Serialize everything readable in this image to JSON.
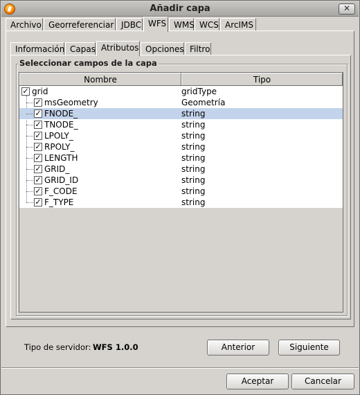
{
  "window": {
    "title": "Añadir capa"
  },
  "main_tabs": [
    "Archivo",
    "Georreferenciar",
    "JDBC",
    "WFS",
    "WMS",
    "WCS",
    "ArcIMS"
  ],
  "main_tab_selected": "WFS",
  "sub_tabs": [
    "Información",
    "Capas",
    "Atributos",
    "Opciones",
    "Filtro"
  ],
  "sub_tab_selected": "Atributos",
  "fields_group": {
    "title": "Seleccionar campos de la capa",
    "columns": [
      "Nombre",
      "Tipo"
    ],
    "rows": [
      {
        "name": "grid",
        "type": "gridType",
        "checked": true,
        "level": 0
      },
      {
        "name": "msGeometry",
        "type": "Geometría",
        "checked": true,
        "level": 1
      },
      {
        "name": "FNODE_",
        "type": "string",
        "checked": true,
        "level": 1,
        "selected": true
      },
      {
        "name": "TNODE_",
        "type": "string",
        "checked": true,
        "level": 1
      },
      {
        "name": "LPOLY_",
        "type": "string",
        "checked": true,
        "level": 1
      },
      {
        "name": "RPOLY_",
        "type": "string",
        "checked": true,
        "level": 1
      },
      {
        "name": "LENGTH",
        "type": "string",
        "checked": true,
        "level": 1
      },
      {
        "name": "GRID_",
        "type": "string",
        "checked": true,
        "level": 1
      },
      {
        "name": "GRID_ID",
        "type": "string",
        "checked": true,
        "level": 1
      },
      {
        "name": "F_CODE",
        "type": "string",
        "checked": true,
        "level": 1
      },
      {
        "name": "F_TYPE",
        "type": "string",
        "checked": true,
        "level": 1
      }
    ]
  },
  "server": {
    "label": "Tipo de servidor:",
    "value": "WFS 1.0.0"
  },
  "buttons": {
    "anterior": "Anterior",
    "siguiente": "Siguiente",
    "aceptar": "Aceptar",
    "cancelar": "Cancelar"
  },
  "colors": {
    "selected_row": "#c3d3eb",
    "panel": "#d6d3ce"
  }
}
